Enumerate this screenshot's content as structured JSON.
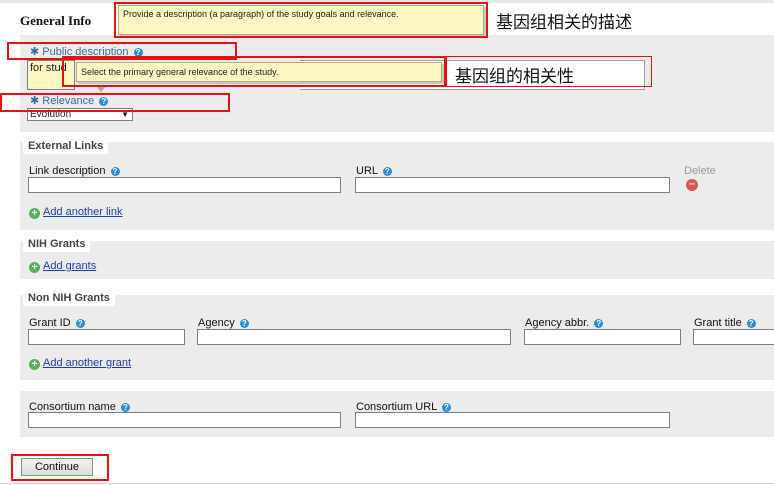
{
  "section": {
    "title": "General Info",
    "title_visible": "General Info"
  },
  "tooltips": {
    "description": "Provide a description (a paragraph) of the study goals and relevance.",
    "relevance": "Select the primary general relevance of the study."
  },
  "annotations": {
    "description_note": "基因组相关的描述",
    "relevance_note": "基因组的相关性"
  },
  "public_description": {
    "label": "Public description",
    "required_marker": "✱",
    "value": "for stud"
  },
  "relevance": {
    "label": "Relevance",
    "required_marker": "✱",
    "selected": "Evolution"
  },
  "external_links": {
    "legend": "External Links",
    "link_description_label": "Link description",
    "url_label": "URL",
    "delete_label": "Delete",
    "add_link": "Add another link"
  },
  "nih_grants": {
    "legend": "NIH Grants",
    "add": "Add grants"
  },
  "non_nih_grants": {
    "legend": "Non NIH Grants",
    "grant_id_label": "Grant ID",
    "agency_label": "Agency",
    "agency_abbr_label": "Agency abbr.",
    "grant_title_label": "Grant title",
    "add": "Add another grant"
  },
  "consortium": {
    "name_label": "Consortium name",
    "url_label": "Consortium URL"
  },
  "actions": {
    "continue": "Continue"
  },
  "icons": {
    "help": "help-icon",
    "add": "plus-icon",
    "delete": "minus-icon"
  },
  "colors": {
    "annotation_border": "#e31313",
    "tooltip_bg": "#fbf8c6",
    "link": "#1a3fb5",
    "help_icon": "#2a8ddc"
  }
}
